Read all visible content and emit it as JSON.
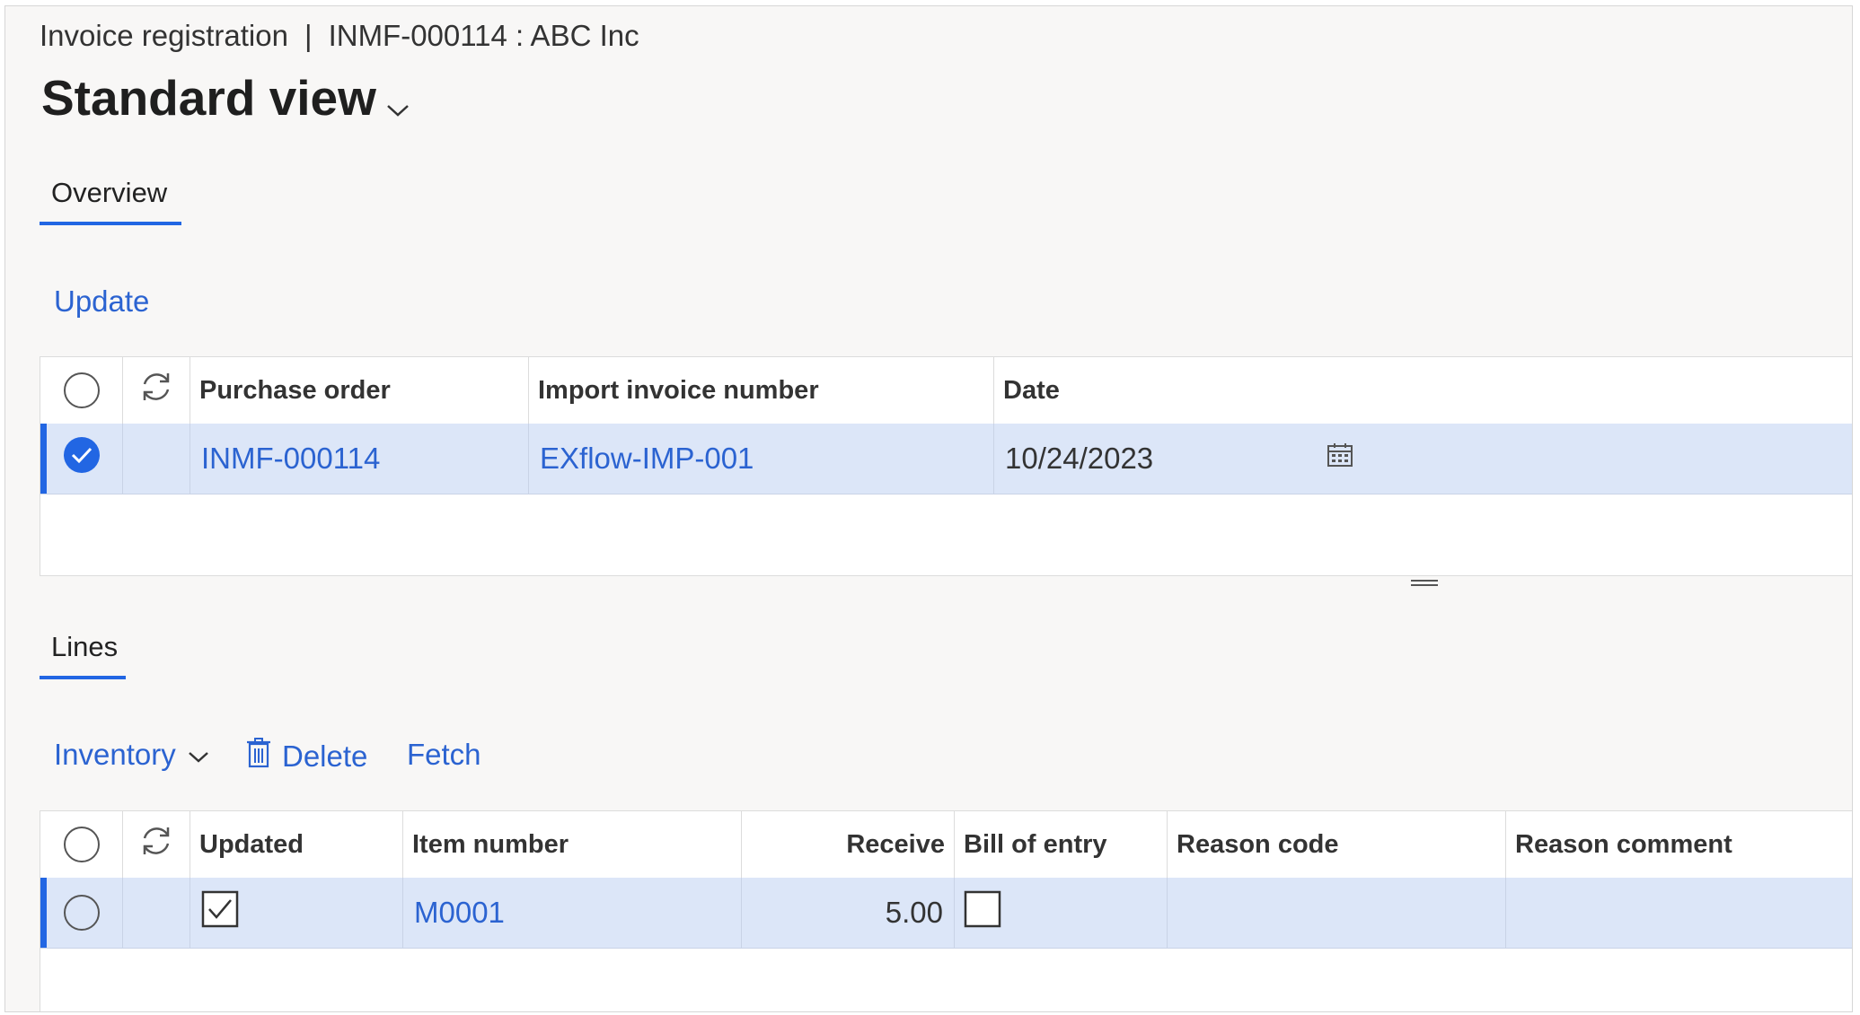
{
  "header": {
    "breadcrumb_page": "Invoice registration",
    "breadcrumb_separator": "|",
    "breadcrumb_record": "INMF-000114 : ABC Inc",
    "view_title": "Standard view"
  },
  "overview": {
    "tab_label": "Overview",
    "update_label": "Update",
    "columns": [
      "Purchase order",
      "Import invoice number",
      "Date"
    ],
    "row": {
      "purchase_order": "INMF-000114",
      "import_invoice_number": "EXflow-IMP-001",
      "date": "10/24/2023",
      "selected": true
    }
  },
  "lines": {
    "tab_label": "Lines",
    "toolbar": {
      "inventory_label": "Inventory",
      "delete_label": "Delete",
      "fetch_label": "Fetch"
    },
    "columns": [
      "Updated",
      "Item number",
      "Receive",
      "Bill of entry",
      "Reason code",
      "Reason comment"
    ],
    "row": {
      "updated": true,
      "item_number": "M0001",
      "receive": "5.00",
      "bill_of_entry": false,
      "reason_code": "",
      "reason_comment": ""
    }
  },
  "colors": {
    "accent": "#2266e3",
    "link": "#2b63d1",
    "selected_row": "#dce6f8",
    "page_background": "#f8f7f6"
  }
}
